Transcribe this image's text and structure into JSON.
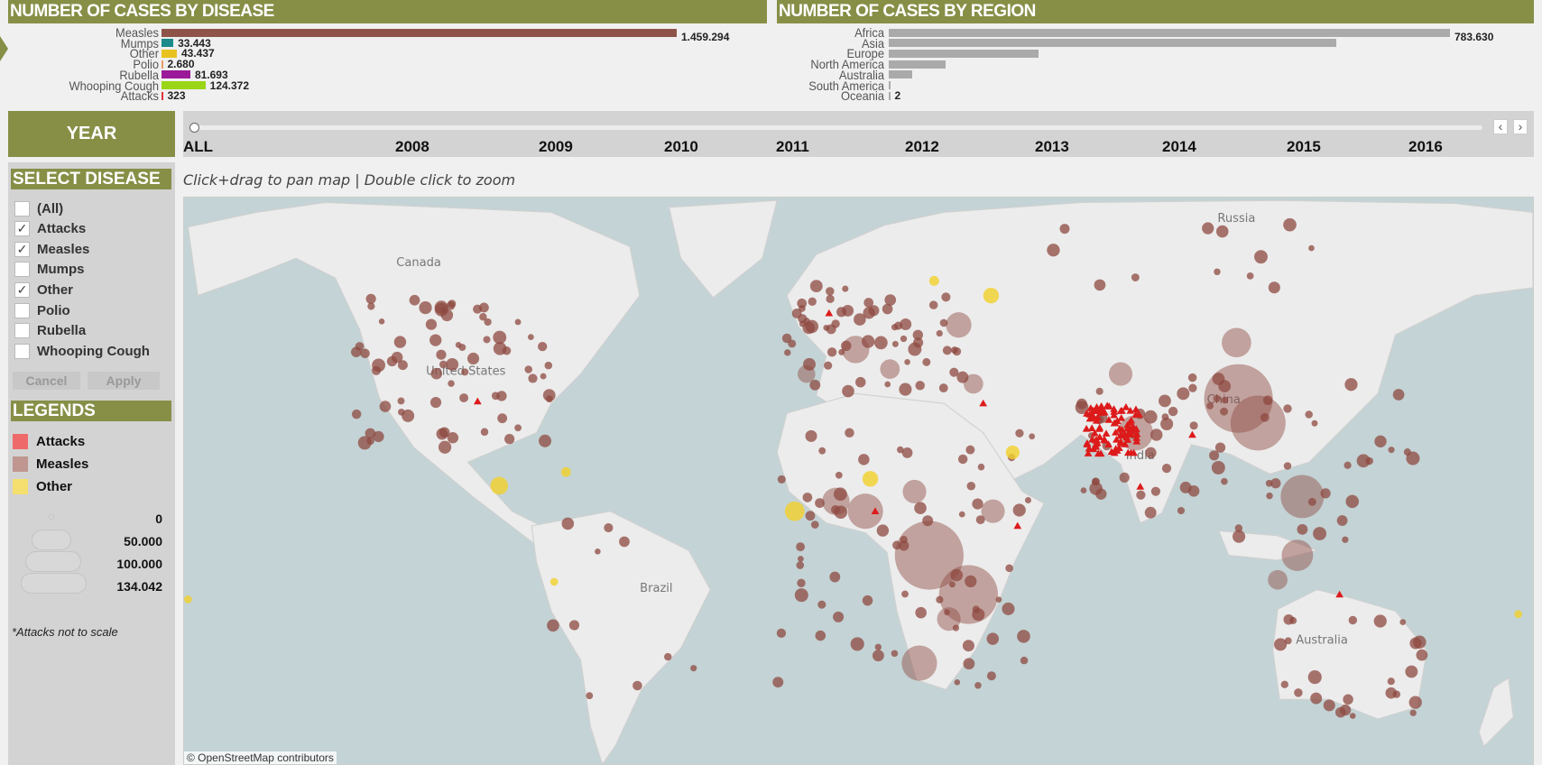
{
  "disease_panel": {
    "title": "NUMBER OF CASES BY DISEASE"
  },
  "region_panel": {
    "title": "NUMBER OF CASES BY REGION"
  },
  "chart_data": [
    {
      "type": "bar",
      "orientation": "horizontal",
      "title": "NUMBER OF CASES BY DISEASE",
      "categories": [
        "Measles",
        "Mumps",
        "Other",
        "Polio",
        "Rubella",
        "Whooping Cough",
        "Attacks"
      ],
      "values": [
        1459294,
        33443,
        43437,
        2680,
        81693,
        124372,
        323
      ],
      "value_labels": [
        "1.459.294",
        "33.443",
        "43.437",
        "2.680",
        "81.693",
        "124.372",
        "323"
      ],
      "colors": [
        "#8e5449",
        "#1a8a8a",
        "#e8c21f",
        "#e89a6a",
        "#9a1a9a",
        "#9ad615",
        "#e0323c"
      ]
    },
    {
      "type": "bar",
      "orientation": "horizontal",
      "title": "NUMBER OF CASES BY REGION",
      "categories": [
        "Africa",
        "Asia",
        "Europe",
        "North America",
        "Australia",
        "South America",
        "Oceania"
      ],
      "values": [
        783630,
        625000,
        209000,
        80000,
        33000,
        3000,
        2
      ],
      "value_labels": [
        "783.630",
        "",
        "",
        "",
        "",
        "",
        "2"
      ],
      "colors": [
        "#aaaaaa"
      ]
    }
  ],
  "year": {
    "label": "YEAR",
    "options": [
      "ALL",
      "2008",
      "2009",
      "2010",
      "2011",
      "2012",
      "2013",
      "2014",
      "2015",
      "2016"
    ],
    "selected": "ALL",
    "prev": "‹",
    "next": "›"
  },
  "filter": {
    "title": "SELECT DISEASE",
    "items": [
      {
        "label": "(All)",
        "checked": false
      },
      {
        "label": "Attacks",
        "checked": true
      },
      {
        "label": "Measles",
        "checked": true
      },
      {
        "label": "Mumps",
        "checked": false
      },
      {
        "label": "Other",
        "checked": true
      },
      {
        "label": "Polio",
        "checked": false
      },
      {
        "label": "Rubella",
        "checked": false
      },
      {
        "label": "Whooping Cough",
        "checked": false
      }
    ],
    "cancel": "Cancel",
    "apply": "Apply"
  },
  "legends": {
    "title": "LEGENDS",
    "items": [
      {
        "label": "Attacks",
        "color": "#ee6a6a"
      },
      {
        "label": "Measles",
        "color": "#bf9690"
      },
      {
        "label": "Other",
        "color": "#f5df6e"
      }
    ],
    "sizes": [
      "0",
      "50.000",
      "100.000",
      "134.042"
    ],
    "note": "*Attacks not to scale"
  },
  "map": {
    "caption": "Click+drag to pan map | Double click to zoom",
    "attribution": "© OpenStreetMap contributors",
    "labels": [
      "Russia",
      "Canada",
      "United States",
      "Brazil",
      "China",
      "India",
      "Australia"
    ],
    "colors": {
      "ocean": "#c4d3d5",
      "land": "#ececec",
      "measles": "#8e4a40",
      "other": "#f2d12a",
      "attacks": "#dd1a1a"
    }
  }
}
